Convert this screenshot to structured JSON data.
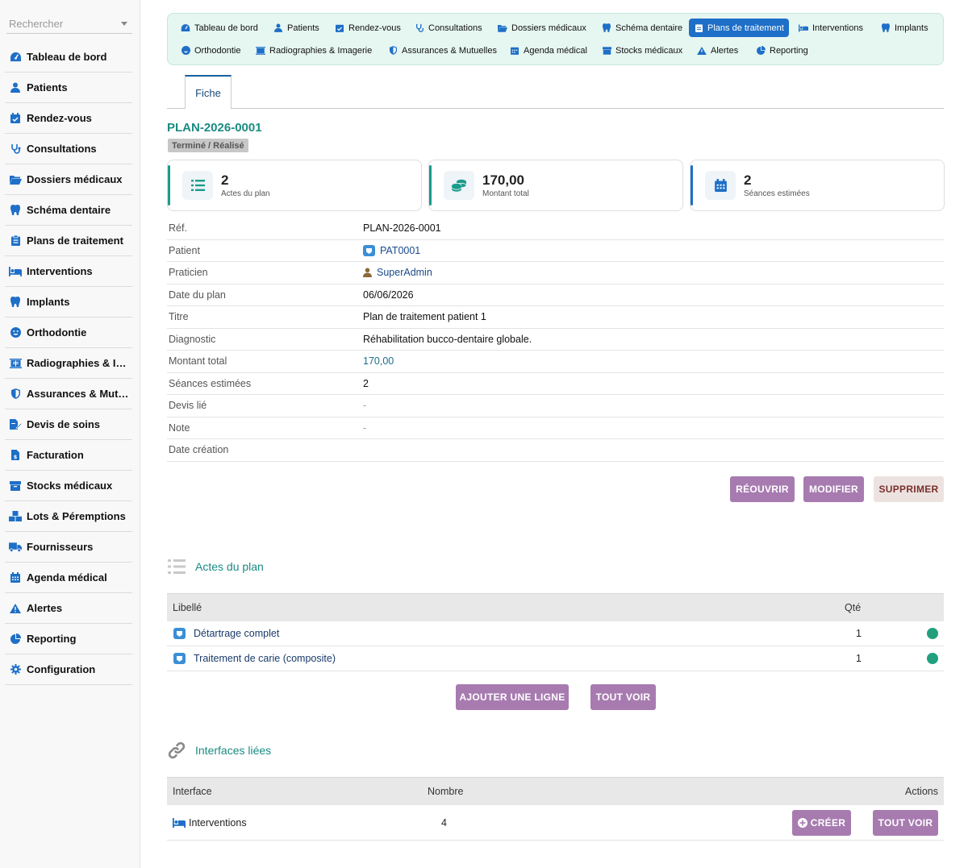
{
  "sidebar": {
    "search_placeholder": "Rechercher",
    "items": [
      {
        "label": "Tableau de bord",
        "icon": "dashboard-icon"
      },
      {
        "label": "Patients",
        "icon": "user-icon"
      },
      {
        "label": "Rendez-vous",
        "icon": "calendar-check-icon"
      },
      {
        "label": "Consultations",
        "icon": "stethoscope-icon"
      },
      {
        "label": "Dossiers médicaux",
        "icon": "folder-open-icon"
      },
      {
        "label": "Schéma dentaire",
        "icon": "tooth-icon"
      },
      {
        "label": "Plans de traitement",
        "icon": "clipboard-icon"
      },
      {
        "label": "Interventions",
        "icon": "bed-icon"
      },
      {
        "label": "Implants",
        "icon": "tooth-icon"
      },
      {
        "label": "Orthodontie",
        "icon": "smile-icon"
      },
      {
        "label": "Radiographies & Ima…",
        "icon": "xray-icon"
      },
      {
        "label": "Assurances & Mutue…",
        "icon": "shield-icon"
      },
      {
        "label": "Devis de soins",
        "icon": "file-signature-icon"
      },
      {
        "label": "Facturation",
        "icon": "invoice-icon"
      },
      {
        "label": "Stocks médicaux",
        "icon": "box-icon"
      },
      {
        "label": "Lots & Péremptions",
        "icon": "boxes-icon"
      },
      {
        "label": "Fournisseurs",
        "icon": "truck-icon"
      },
      {
        "label": "Agenda médical",
        "icon": "calendar-icon"
      },
      {
        "label": "Alertes",
        "icon": "warning-icon"
      },
      {
        "label": "Reporting",
        "icon": "pie-chart-icon"
      },
      {
        "label": "Configuration",
        "icon": "gear-icon"
      }
    ]
  },
  "topmenu": {
    "row1": [
      {
        "label": "Tableau de bord",
        "icon": "dashboard-icon"
      },
      {
        "label": "Patients",
        "icon": "user-icon"
      },
      {
        "label": "Rendez-vous",
        "icon": "calendar-check-icon"
      },
      {
        "label": "Consultations",
        "icon": "stethoscope-icon"
      },
      {
        "label": "Dossiers médicaux",
        "icon": "folder-open-icon"
      },
      {
        "label": "Schéma dentaire",
        "icon": "tooth-icon"
      },
      {
        "label": "Plans de traitement",
        "icon": "clipboard-icon",
        "active": true
      },
      {
        "label": "Interventions",
        "icon": "bed-icon"
      },
      {
        "label": "Implants",
        "icon": "tooth-icon"
      }
    ],
    "row2": [
      {
        "label": "Orthodontie",
        "icon": "smile-icon"
      },
      {
        "label": "Radiographies & Imagerie",
        "icon": "xray-icon"
      },
      {
        "label": "Assurances & Mutuelles",
        "icon": "shield-icon"
      },
      {
        "label": "Agenda médical",
        "icon": "calendar-icon"
      },
      {
        "label": "Stocks médicaux",
        "icon": "box-icon"
      },
      {
        "label": "Alertes",
        "icon": "warning-icon"
      },
      {
        "label": "Reporting",
        "icon": "pie-chart-icon"
      }
    ]
  },
  "tabs": {
    "fiche": "Fiche"
  },
  "plan": {
    "ref": "PLAN-2026-0001",
    "status": "Terminé / Réalisé"
  },
  "stats": [
    {
      "value": "2",
      "label": "Actes du plan",
      "color": "#1a9c8b",
      "icon": "list-icon"
    },
    {
      "value": "170,00",
      "label": "Montant total",
      "color": "#1a9c8b",
      "icon": "coins-icon"
    },
    {
      "value": "2",
      "label": "Séances estimées",
      "color": "#1e6fc7",
      "icon": "calendar-icon"
    }
  ],
  "details": [
    {
      "key": "Réf.",
      "value": "PLAN-2026-0001",
      "style": ""
    },
    {
      "key": "Patient",
      "value": "PAT0001",
      "style": "link",
      "icon": "patient-badge-icon"
    },
    {
      "key": "Praticien",
      "value": "SuperAdmin",
      "style": "link",
      "icon": "user-icon"
    },
    {
      "key": "Date du plan",
      "value": "06/06/2026",
      "style": ""
    },
    {
      "key": "Titre",
      "value": "Plan de traitement patient 1",
      "style": ""
    },
    {
      "key": "Diagnostic",
      "value": "Réhabilitation bucco-dentaire globale.",
      "style": ""
    },
    {
      "key": "Montant total",
      "value": "170,00",
      "style": "teal"
    },
    {
      "key": "Séances estimées",
      "value": "2",
      "style": ""
    },
    {
      "key": "Devis lié",
      "value": "-",
      "style": "muted"
    },
    {
      "key": "Note",
      "value": "-",
      "style": "muted"
    },
    {
      "key": "Date création",
      "value": "",
      "style": ""
    }
  ],
  "actions": {
    "reopen": "RÉOUVRIR",
    "edit": "MODIFIER",
    "delete": "SUPPRIMER"
  },
  "lines_section": {
    "title": "Actes du plan",
    "col_label": "Libellé",
    "col_qty": "Qté",
    "rows": [
      {
        "label": "Détartrage complet",
        "qty": "1",
        "status_color": "#22a07e"
      },
      {
        "label": "Traitement de carie (composite)",
        "qty": "1",
        "status_color": "#22a07e"
      }
    ],
    "add_button": "AJOUTER UNE LIGNE",
    "see_all": "TOUT VOIR"
  },
  "linked_section": {
    "title": "Interfaces liées",
    "col_interface": "Interface",
    "col_count": "Nombre",
    "col_actions": "Actions",
    "rows": [
      {
        "interface": "Interventions",
        "count": "4",
        "icon": "bed-icon"
      }
    ],
    "create_button": "CRÉER",
    "see_all": "TOUT VOIR"
  },
  "colors": {
    "accent_teal": "#1a8b82",
    "active_blue": "#1e6fc7",
    "button_purple": "#a77bb0"
  }
}
